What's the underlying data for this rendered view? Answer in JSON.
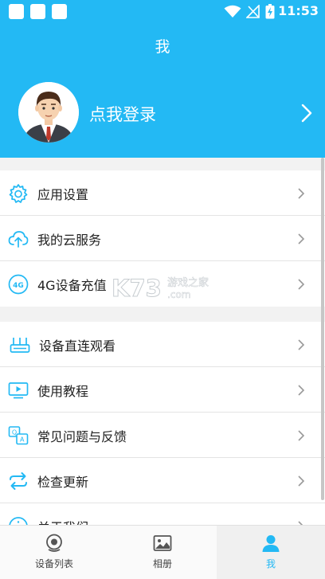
{
  "status_bar": {
    "time": "11:53"
  },
  "header": {
    "title": "我",
    "login_text": "点我登录"
  },
  "menu_group_1": [
    {
      "label": "应用设置",
      "icon": "gear-icon"
    },
    {
      "label": "我的云服务",
      "icon": "cloud-upload-icon"
    },
    {
      "label": "4G设备充值",
      "icon": "4g-icon"
    }
  ],
  "menu_group_2": [
    {
      "label": "设备直连观看",
      "icon": "router-icon"
    },
    {
      "label": "使用教程",
      "icon": "video-tutorial-icon"
    },
    {
      "label": "常见问题与反馈",
      "icon": "faq-icon"
    },
    {
      "label": "检查更新",
      "icon": "refresh-icon"
    },
    {
      "label": "关于我们",
      "icon": "info-icon"
    }
  ],
  "watermark": {
    "brand": "K73",
    "site_name": "游戏之家",
    "domain": ".com"
  },
  "bottom_nav": [
    {
      "label": "设备列表",
      "icon": "camera-icon"
    },
    {
      "label": "相册",
      "icon": "photo-album-icon"
    },
    {
      "label": "我",
      "icon": "user-icon",
      "active": true
    }
  ],
  "colors": {
    "primary": "#23b9f4",
    "text": "#222222",
    "divider": "#e4e4e4",
    "background": "#f2f2f2"
  }
}
